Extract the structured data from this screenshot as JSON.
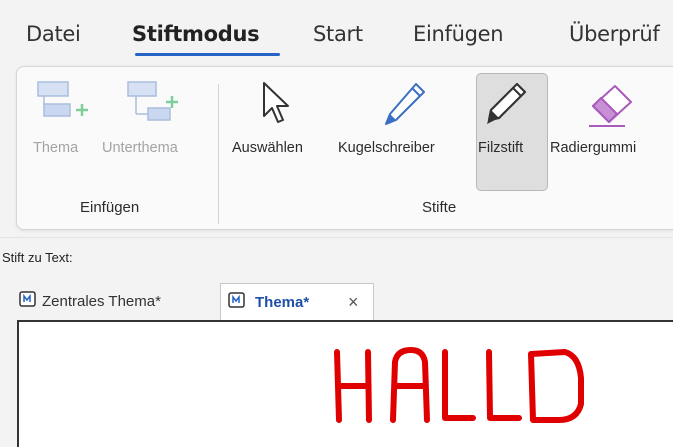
{
  "menu_tabs": [
    {
      "label": "Datei"
    },
    {
      "label": "Stiftmodus"
    },
    {
      "label": "Start"
    },
    {
      "label": "Einfügen"
    },
    {
      "label": "Überprüf"
    }
  ],
  "ribbon": {
    "groups": [
      {
        "label": "Einfügen"
      },
      {
        "label": "Stifte"
      }
    ],
    "buttons": {
      "thema": {
        "label": "Thema"
      },
      "unterthema": {
        "label": "Unterthema"
      },
      "auswaehlen": {
        "label": "Auswählen"
      },
      "kugelschreiber": {
        "label": "Kugelschreiber"
      },
      "filzstift": {
        "label": "Filzstift"
      },
      "radiergummi": {
        "label": "Radiergummi"
      }
    }
  },
  "pen_to_text_label": "Stift zu Text:",
  "document_tabs": [
    {
      "label": "Zentrales Thema*"
    },
    {
      "label": "Thema*"
    }
  ],
  "close_glyph": "×",
  "ink_text": "HALLO",
  "colors": {
    "accent": "#2364c5",
    "ink": "#e00000",
    "eraser": "#c070d0",
    "active_tab_text": "#1f4fa8"
  }
}
